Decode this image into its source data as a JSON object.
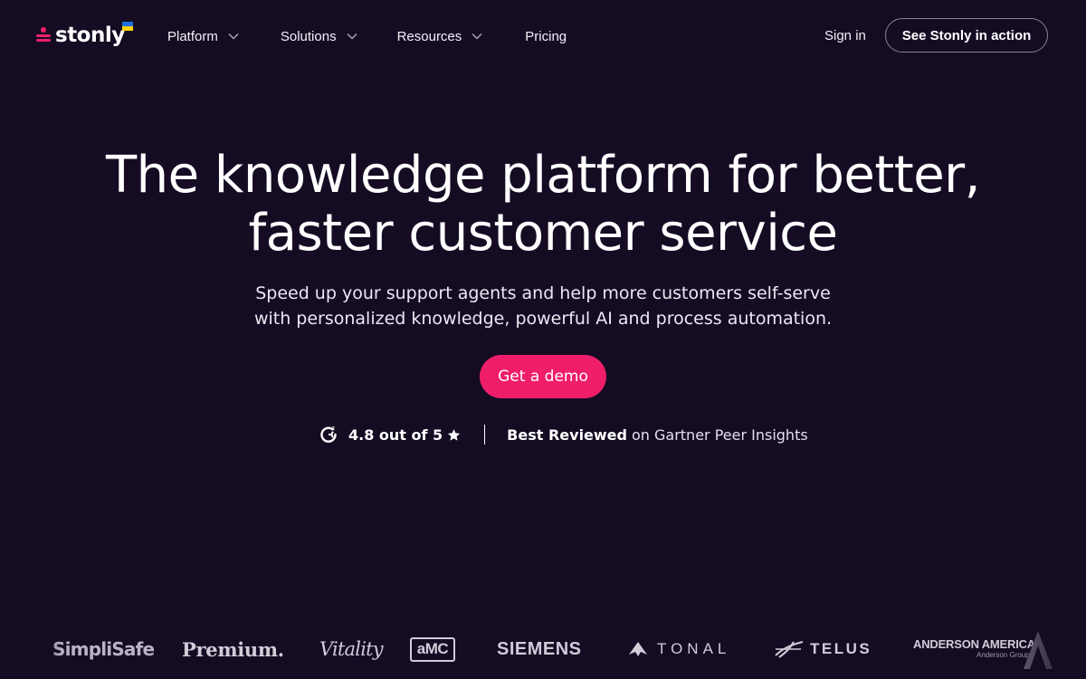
{
  "brand": {
    "name": "stonly",
    "accent_color": "#f01e6a",
    "background_color": "#150c24"
  },
  "nav": {
    "items": [
      {
        "label": "Platform",
        "has_dropdown": true
      },
      {
        "label": "Solutions",
        "has_dropdown": true
      },
      {
        "label": "Resources",
        "has_dropdown": true
      },
      {
        "label": "Pricing",
        "has_dropdown": false
      }
    ],
    "sign_in_label": "Sign in",
    "cta_label": "See Stonly in action"
  },
  "hero": {
    "title_line1": "The knowledge platform for better,",
    "title_line2": "faster customer service",
    "subtitle_line1": "Speed up your support agents and help more customers self-serve",
    "subtitle_line2": "with personalized knowledge, powerful AI and process automation.",
    "cta_label": "Get a demo"
  },
  "rating": {
    "score_text": "4.8 out of 5",
    "icon": "g2-icon",
    "best_label": "Best Reviewed",
    "source_text": "on Gartner Peer Insights"
  },
  "customer_logos": [
    {
      "name": "SimpliSafe",
      "text": "SimpliSafe"
    },
    {
      "name": "Premium",
      "text": "Premium."
    },
    {
      "name": "Vitality",
      "text": "Vitality"
    },
    {
      "name": "AMC",
      "text": "aMC"
    },
    {
      "name": "Siemens",
      "text": "SIEMENS"
    },
    {
      "name": "Tonal",
      "text": "TONAL"
    },
    {
      "name": "Telus",
      "text": "TELUS"
    },
    {
      "name": "Anderson America",
      "text": "ANDERSON AMERICA",
      "subtext": "Anderson Group"
    }
  ]
}
